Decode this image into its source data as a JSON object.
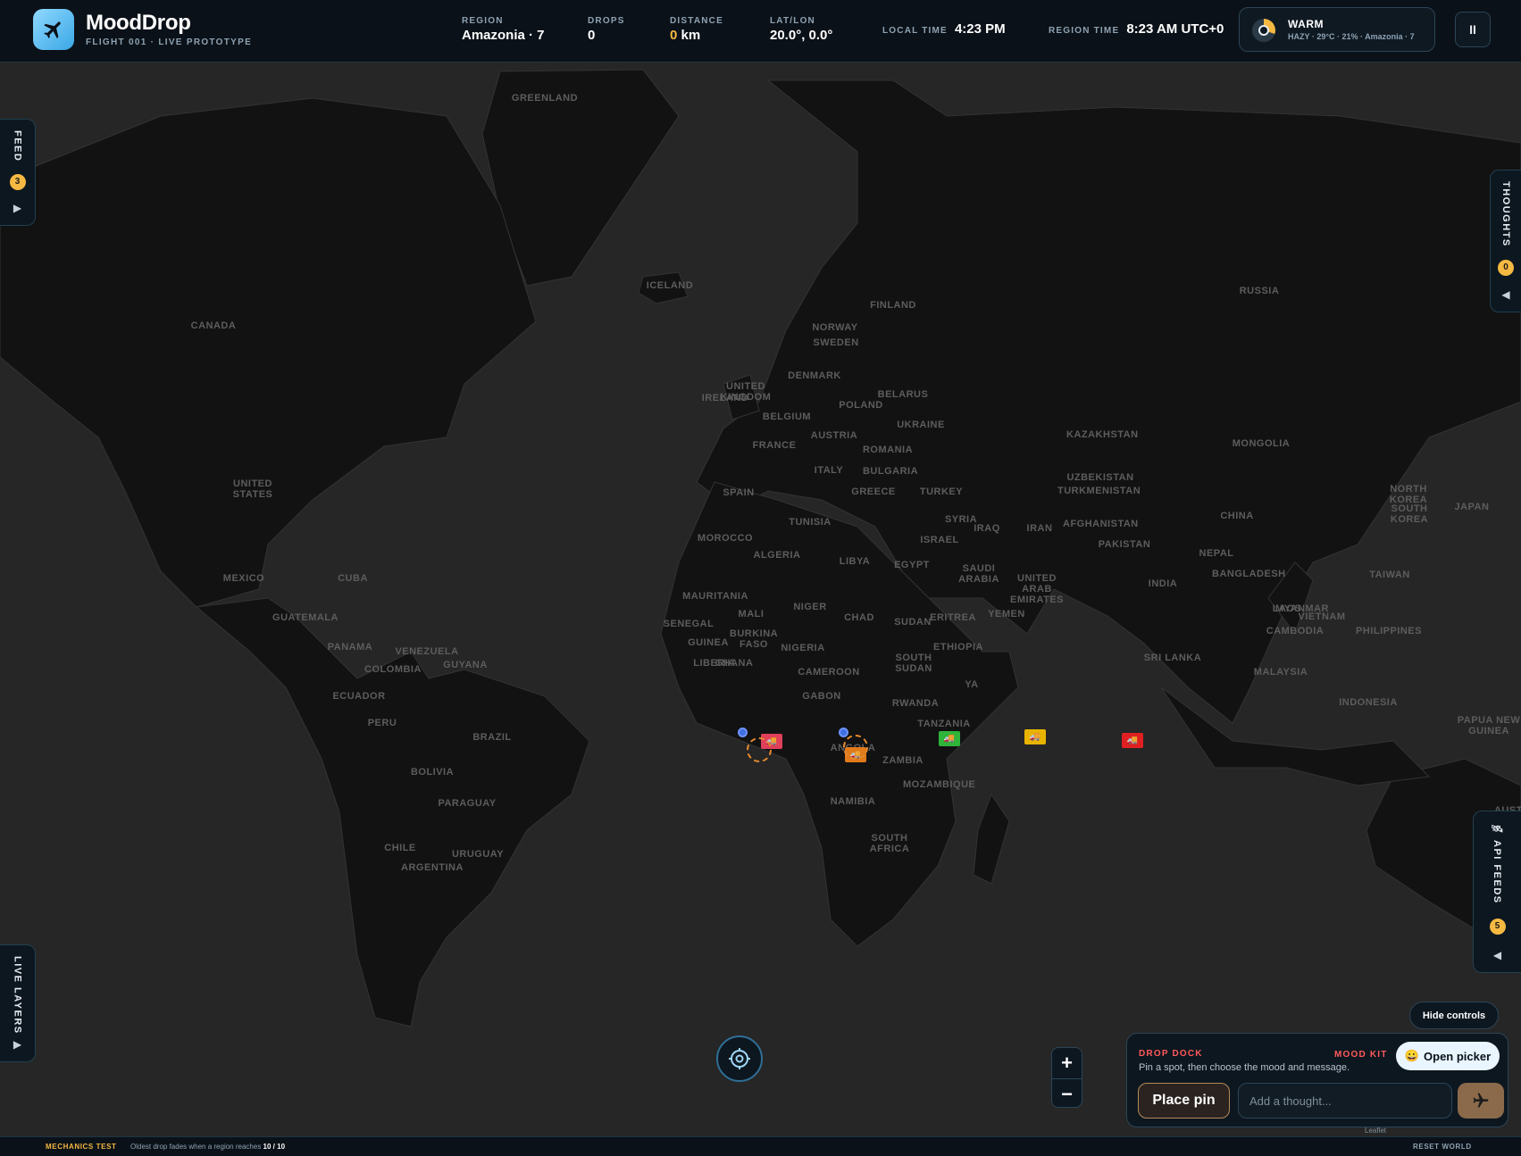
{
  "header": {
    "title": "MoodDrop",
    "subtitle": "FLIGHT 001 · LIVE PROTOTYPE",
    "stats": {
      "region_label": "REGION",
      "region_value": "Amazonia · 7",
      "drops_label": "DROPS",
      "drops_value": "0",
      "distance_label": "DISTANCE",
      "distance_value": "0",
      "distance_unit": " km",
      "latlon_label": "LAT/LON",
      "latlon_value": "20.0°, 0.0°",
      "local_time_label": "LOCAL TIME",
      "local_time_value": "4:23 PM",
      "region_time_label": "REGION TIME",
      "region_time_value": "8:23 AM UTC+0"
    },
    "weather": {
      "title": "WARM",
      "detail": "HAZY · 29°C · 21% · Amazonia · 7"
    },
    "pause_label": "II"
  },
  "map": {
    "labels": [
      {
        "text": "GREENLAND"
      },
      {
        "text": "ICELAND"
      },
      {
        "text": "CANADA"
      },
      {
        "text": "UNITED\nSTATES"
      },
      {
        "text": "MEXICO"
      },
      {
        "text": "CUBA"
      },
      {
        "text": "GUATEMALA"
      },
      {
        "text": "PANAMA"
      },
      {
        "text": "VENEZUELA"
      },
      {
        "text": "GUYANA"
      },
      {
        "text": "COLOMBIA"
      },
      {
        "text": "ECUADOR"
      },
      {
        "text": "PERU"
      },
      {
        "text": "BRAZIL"
      },
      {
        "text": "BOLIVIA"
      },
      {
        "text": "PARAGUAY"
      },
      {
        "text": "CHILE"
      },
      {
        "text": "URUGUAY"
      },
      {
        "text": "ARGENTINA"
      },
      {
        "text": "NORWAY"
      },
      {
        "text": "SWEDEN"
      },
      {
        "text": "FINLAND"
      },
      {
        "text": "UNITED\nKINGDOM"
      },
      {
        "text": "IRELAND"
      },
      {
        "text": "DENMARK"
      },
      {
        "text": "BELARUS"
      },
      {
        "text": "POLAND"
      },
      {
        "text": "BELGIUM"
      },
      {
        "text": "UKRAINE"
      },
      {
        "text": "FRANCE"
      },
      {
        "text": "AUSTRIA"
      },
      {
        "text": "ROMANIA"
      },
      {
        "text": "ITALY"
      },
      {
        "text": "BULGARIA"
      },
      {
        "text": "SPAIN"
      },
      {
        "text": "GREECE"
      },
      {
        "text": "TURKEY"
      },
      {
        "text": "RUSSIA"
      },
      {
        "text": "KAZAKHSTAN"
      },
      {
        "text": "MONGOLIA"
      },
      {
        "text": "UZBEKISTAN"
      },
      {
        "text": "TURKMENISTAN"
      },
      {
        "text": "NORTH\nKOREA"
      },
      {
        "text": "SOUTH\nKOREA"
      },
      {
        "text": "JAPAN"
      },
      {
        "text": "CHINA"
      },
      {
        "text": "SYRIA"
      },
      {
        "text": "IRAQ"
      },
      {
        "text": "IRAN"
      },
      {
        "text": "AFGHANISTAN"
      },
      {
        "text": "ISRAEL"
      },
      {
        "text": "PAKISTAN"
      },
      {
        "text": "NEPAL"
      },
      {
        "text": "TUNISIA"
      },
      {
        "text": "MOROCCO"
      },
      {
        "text": "ALGERIA"
      },
      {
        "text": "LIBYA"
      },
      {
        "text": "EGYPT"
      },
      {
        "text": "SAUDI\nARABIA"
      },
      {
        "text": "UNITED\nARAB\nEMIRATES"
      },
      {
        "text": "BANGLADESH"
      },
      {
        "text": "TAIWAN"
      },
      {
        "text": "INDIA"
      },
      {
        "text": "MYANMAR"
      },
      {
        "text": "LAOS"
      },
      {
        "text": "VIETNAM"
      },
      {
        "text": "CAMBODIA"
      },
      {
        "text": "PHILIPPINES"
      },
      {
        "text": "MAURITANIA"
      },
      {
        "text": "MALI"
      },
      {
        "text": "NIGER"
      },
      {
        "text": "CHAD"
      },
      {
        "text": "SUDAN"
      },
      {
        "text": "ERITREA"
      },
      {
        "text": "YEMEN"
      },
      {
        "text": "SENEGAL"
      },
      {
        "text": "GUINEA"
      },
      {
        "text": "BURKINA\nFASO"
      },
      {
        "text": "NIGERIA"
      },
      {
        "text": "ETHIOPIA"
      },
      {
        "text": "GHANA"
      },
      {
        "text": "SOUTH\nSUDAN"
      },
      {
        "text": "LIBERIA"
      },
      {
        "text": "CAMEROON"
      },
      {
        "text": "SRI LANKA"
      },
      {
        "text": "MALAYSIA"
      },
      {
        "text": "GABON"
      },
      {
        "text": "YA"
      },
      {
        "text": "RWANDA"
      },
      {
        "text": "TANZANIA"
      },
      {
        "text": "INDONESIA"
      },
      {
        "text": "PAPUA NEW\nGUINEA"
      },
      {
        "text": "ANGOLA"
      },
      {
        "text": "ZAMBIA"
      },
      {
        "text": "MOZAMBIQUE"
      },
      {
        "text": "NAMIBIA"
      },
      {
        "text": "SOUTH\nAFRICA"
      },
      {
        "text": "AUSTRALIA"
      }
    ],
    "pins": [
      {
        "color": "#e0405a",
        "icon": "truck-icon"
      },
      {
        "color": "#e07a1a",
        "icon": "truck-icon"
      },
      {
        "color": "#2fb53a",
        "icon": "truck-icon"
      },
      {
        "color": "#e8b400",
        "icon": "truck-icon"
      },
      {
        "color": "#e02020",
        "icon": "truck-icon"
      }
    ]
  },
  "panels": {
    "feed_label": "FEED",
    "feed_count": "3",
    "thoughts_label": "THOUGHTS",
    "thoughts_count": "0",
    "api_label": "API FEEDS",
    "api_count": "5",
    "layers_label": "LIVE LAYERS"
  },
  "controls": {
    "hide_controls": "Hide controls",
    "zoom_in": "+",
    "zoom_out": "−"
  },
  "dock": {
    "title": "DROP DOCK",
    "hint": "Pin a spot, then choose the mood and message.",
    "mood_kit_label": "MOOD KIT",
    "picker_label": "Open picker",
    "picker_emoji": "😀",
    "place_pin": "Place pin",
    "thought_placeholder": "Add a thought...",
    "attribution": "Leaflet"
  },
  "footer": {
    "mechanics_label": "MECHANICS TEST",
    "mechanics_text": "Oldest drop fades when a region reaches ",
    "mechanics_value": "10 / 10",
    "reset": "RESET WORLD"
  },
  "colors": {
    "accent": "#f5b942",
    "brand": "#3ba7e6",
    "danger": "#ff5a5a"
  }
}
